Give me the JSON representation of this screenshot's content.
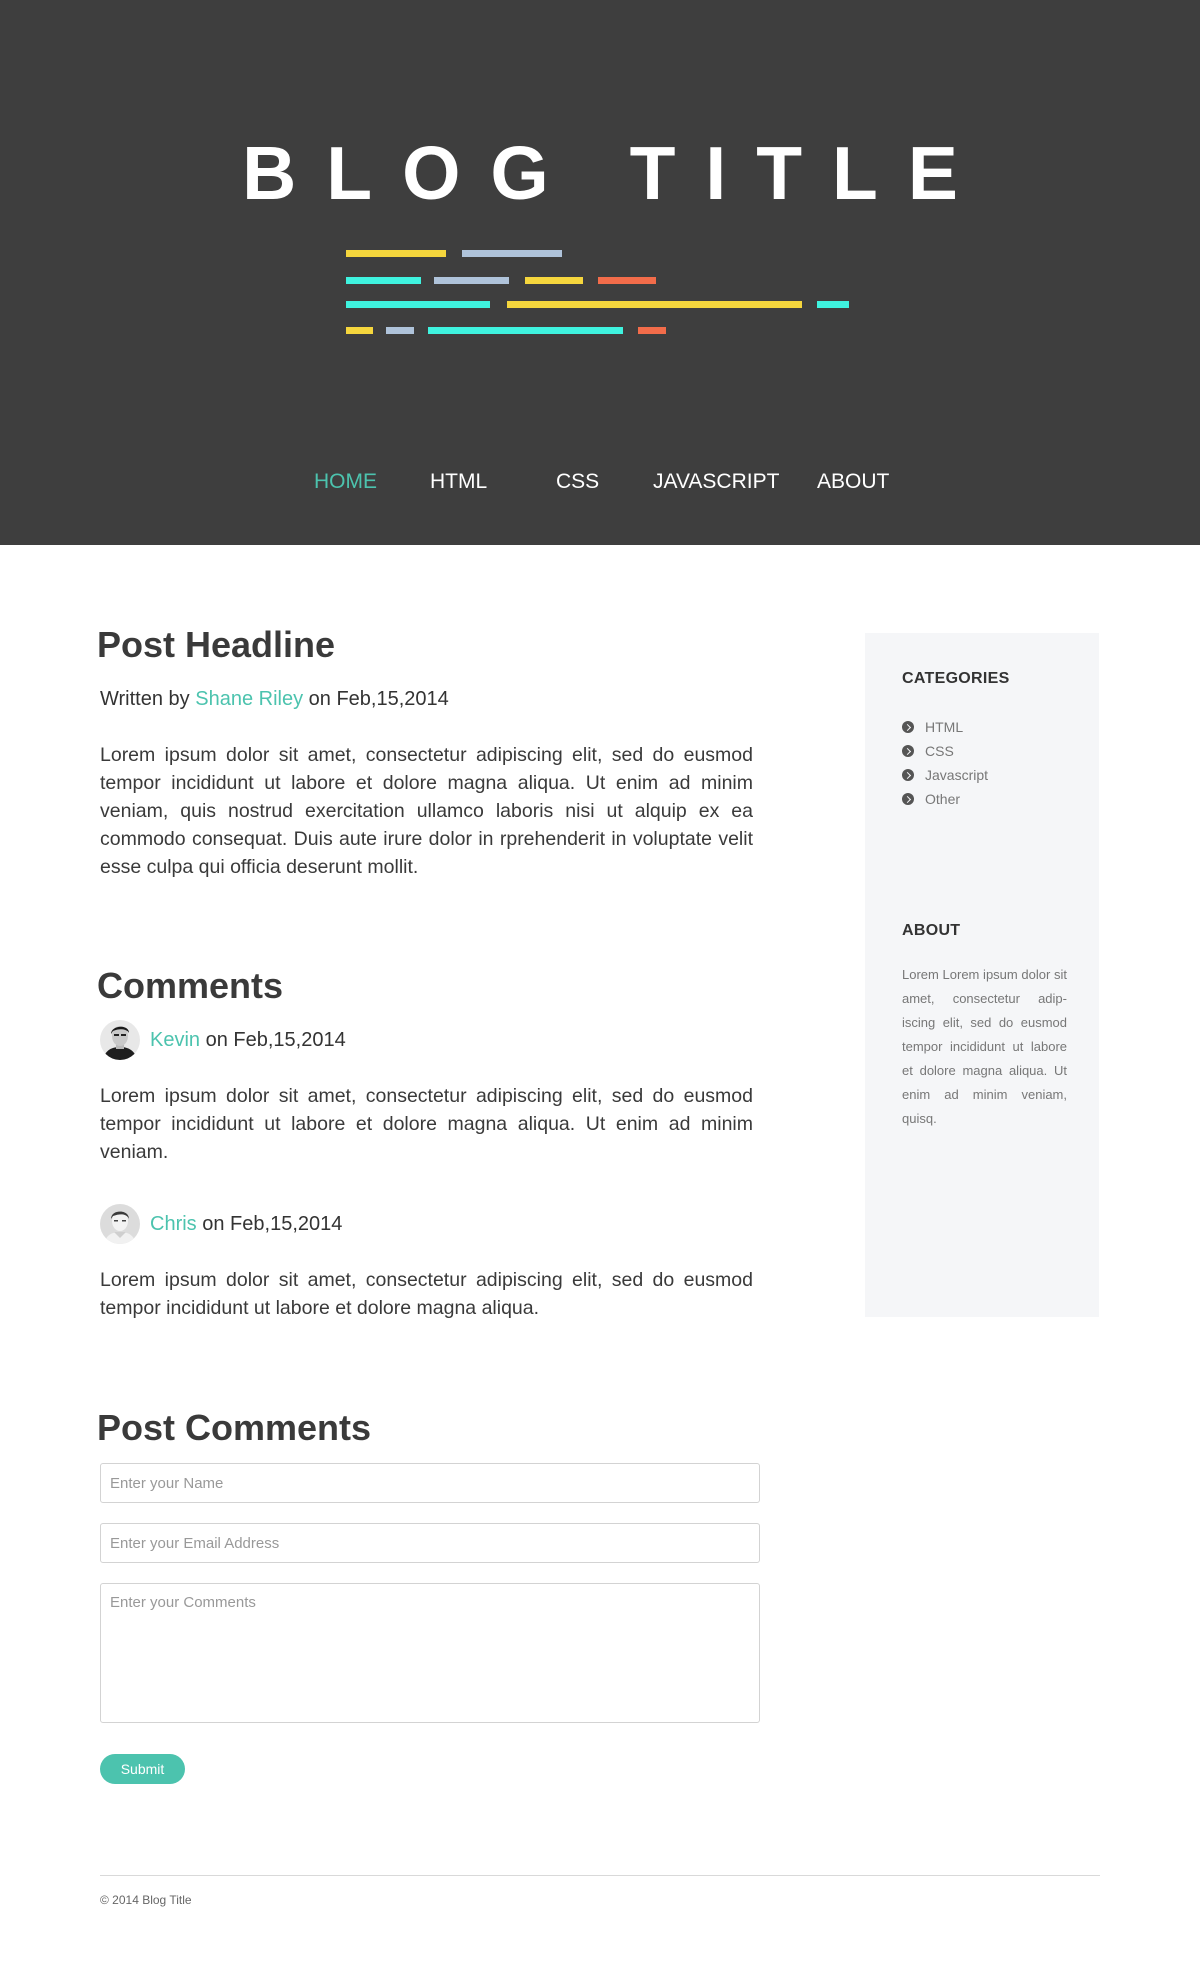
{
  "header": {
    "title": "BLOG TITLE",
    "accent_colors": {
      "yellow": "#f5d63d",
      "blue_gray": "#afc3da",
      "cyan": "#3ff3df",
      "orange": "#f26c4a"
    }
  },
  "nav": {
    "items": [
      {
        "label": "HOME",
        "active": true
      },
      {
        "label": "HTML",
        "active": false
      },
      {
        "label": "CSS",
        "active": false
      },
      {
        "label": "JAVASCRIPT",
        "active": false
      },
      {
        "label": "ABOUT",
        "active": false
      }
    ]
  },
  "post": {
    "headline": "Post Headline",
    "byline_prefix": "Written by",
    "author": "Shane Riley",
    "byline_on": "on",
    "date": "Feb,15,2014",
    "body": "Lorem ipsum dolor sit amet, consectetur adipiscing elit, sed do eusmod tempor incididunt ut labore et dolore magna aliqua. Ut enim ad minim veniam, quis nostrud exercitation ullamco laboris nisi ut alquip ex ea commodo consequat. Duis aute irure dolor in rprehenderit in voluptate velit esse culpa qui officia deserunt mollit."
  },
  "comments": {
    "title": "Comments",
    "items": [
      {
        "name": "Kevin",
        "on": "on",
        "date": "Feb,15,2014",
        "text": "Lorem ipsum dolor sit amet, consectetur adipiscing elit, sed do eusmod tempor incididunt ut labore et dolore magna aliqua. Ut enim ad minim veniam."
      },
      {
        "name": "Chris",
        "on": "on",
        "date": "Feb,15,2014",
        "text": "Lorem ipsum dolor sit amet, consectetur adipiscing elit, sed do eusmod tempor incididunt ut labore et dolore magna aliqua."
      }
    ]
  },
  "form": {
    "title": "Post Comments",
    "name_placeholder": "Enter your Name",
    "email_placeholder": "Enter your Email Address",
    "comments_placeholder": "Enter your Comments",
    "submit_label": "Submit"
  },
  "sidebar": {
    "categories_heading": "CATEGORIES",
    "categories": [
      "HTML",
      "CSS",
      "Javascript",
      "Other"
    ],
    "about_heading": "ABOUT",
    "about_text": "Lorem Lorem ipsum dolor sit amet, consectetur adip-iscing elit, sed do eusmod tempor incididunt ut labore et dolore magna aliqua. Ut enim ad minim veniam, quisq."
  },
  "footer": {
    "copyright": "© 2014 Blog Title"
  }
}
